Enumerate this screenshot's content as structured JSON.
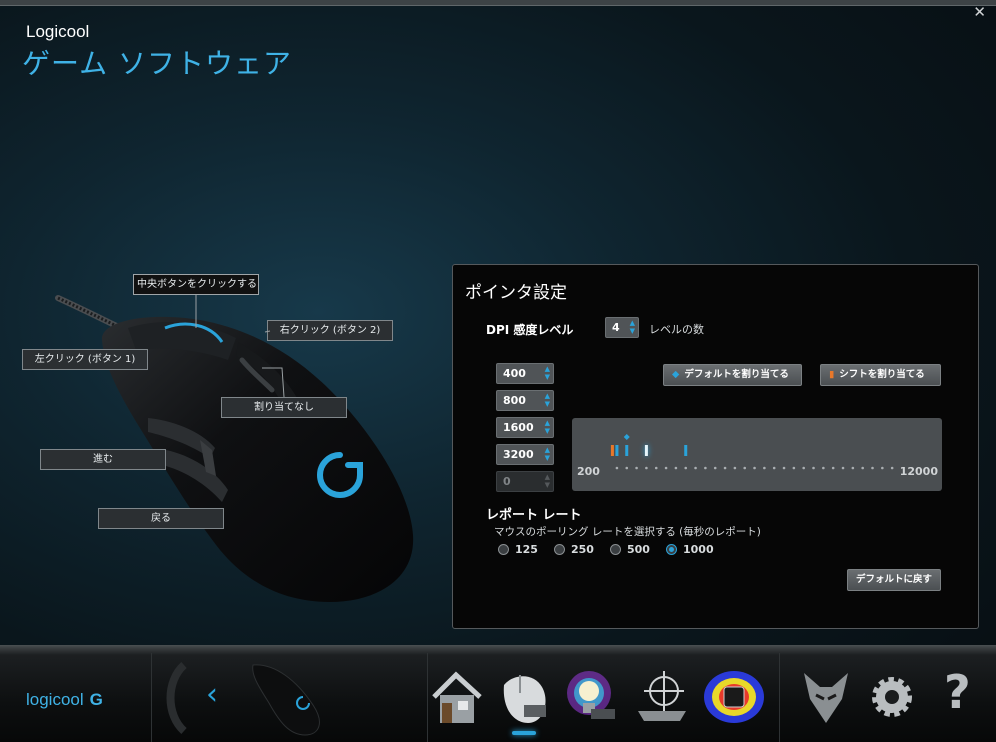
{
  "window": {
    "close_glyph": "✕"
  },
  "header": {
    "brand": "Logicool",
    "title": "ゲーム ソフトウェア"
  },
  "mouse": {
    "buttons": {
      "middle": "中央ボタンをクリックする (ボタ",
      "right": "右クリック (ボタン 2)",
      "left": "左クリック (ボタン 1)",
      "unassigned": "割り当てなし",
      "forward": "進む",
      "back": "戻る"
    }
  },
  "pointer_settings": {
    "title": "ポインタ設定",
    "dpi_label": "DPI 感度レベル",
    "level_count": "4",
    "level_count_label": "レベルの数",
    "dpi_levels": [
      {
        "value": "400",
        "enabled": true
      },
      {
        "value": "800",
        "enabled": true
      },
      {
        "value": "1600",
        "enabled": true
      },
      {
        "value": "3200",
        "enabled": true
      },
      {
        "value": "0",
        "enabled": false
      }
    ],
    "assign_default_label": "デフォルトを割り当てる",
    "assign_shift_label": "シフトを割り当てる",
    "slider": {
      "min_label": "200",
      "max_label": "12000",
      "min": 200,
      "max": 12000,
      "default_dpi": 800,
      "shift_dpi": 400,
      "current_dpi": 1600
    },
    "report_rate_title": "レポート レート",
    "report_rate_sub": "マウスのポーリング レートを選択する (毎秒のレポート)",
    "report_rates": [
      "125",
      "250",
      "500",
      "1000"
    ],
    "selected_rate": "1000",
    "restore_default_label": "デフォルトに戻す"
  },
  "bottom_bar": {
    "logo": "logicool",
    "logo_mark": "G",
    "back_glyph": "‹",
    "nav_icons": [
      "home-icon",
      "pointer-settings-icon",
      "lighting-icon",
      "precision-aim-icon",
      "heatmap-icon",
      "arx-icon",
      "settings-icon",
      "help-icon"
    ],
    "active_nav": "pointer-settings-icon",
    "help_glyph": "?"
  },
  "colors": {
    "accent": "#2aa3da",
    "shift": "#e8782a",
    "title": "#3fb2e6"
  }
}
